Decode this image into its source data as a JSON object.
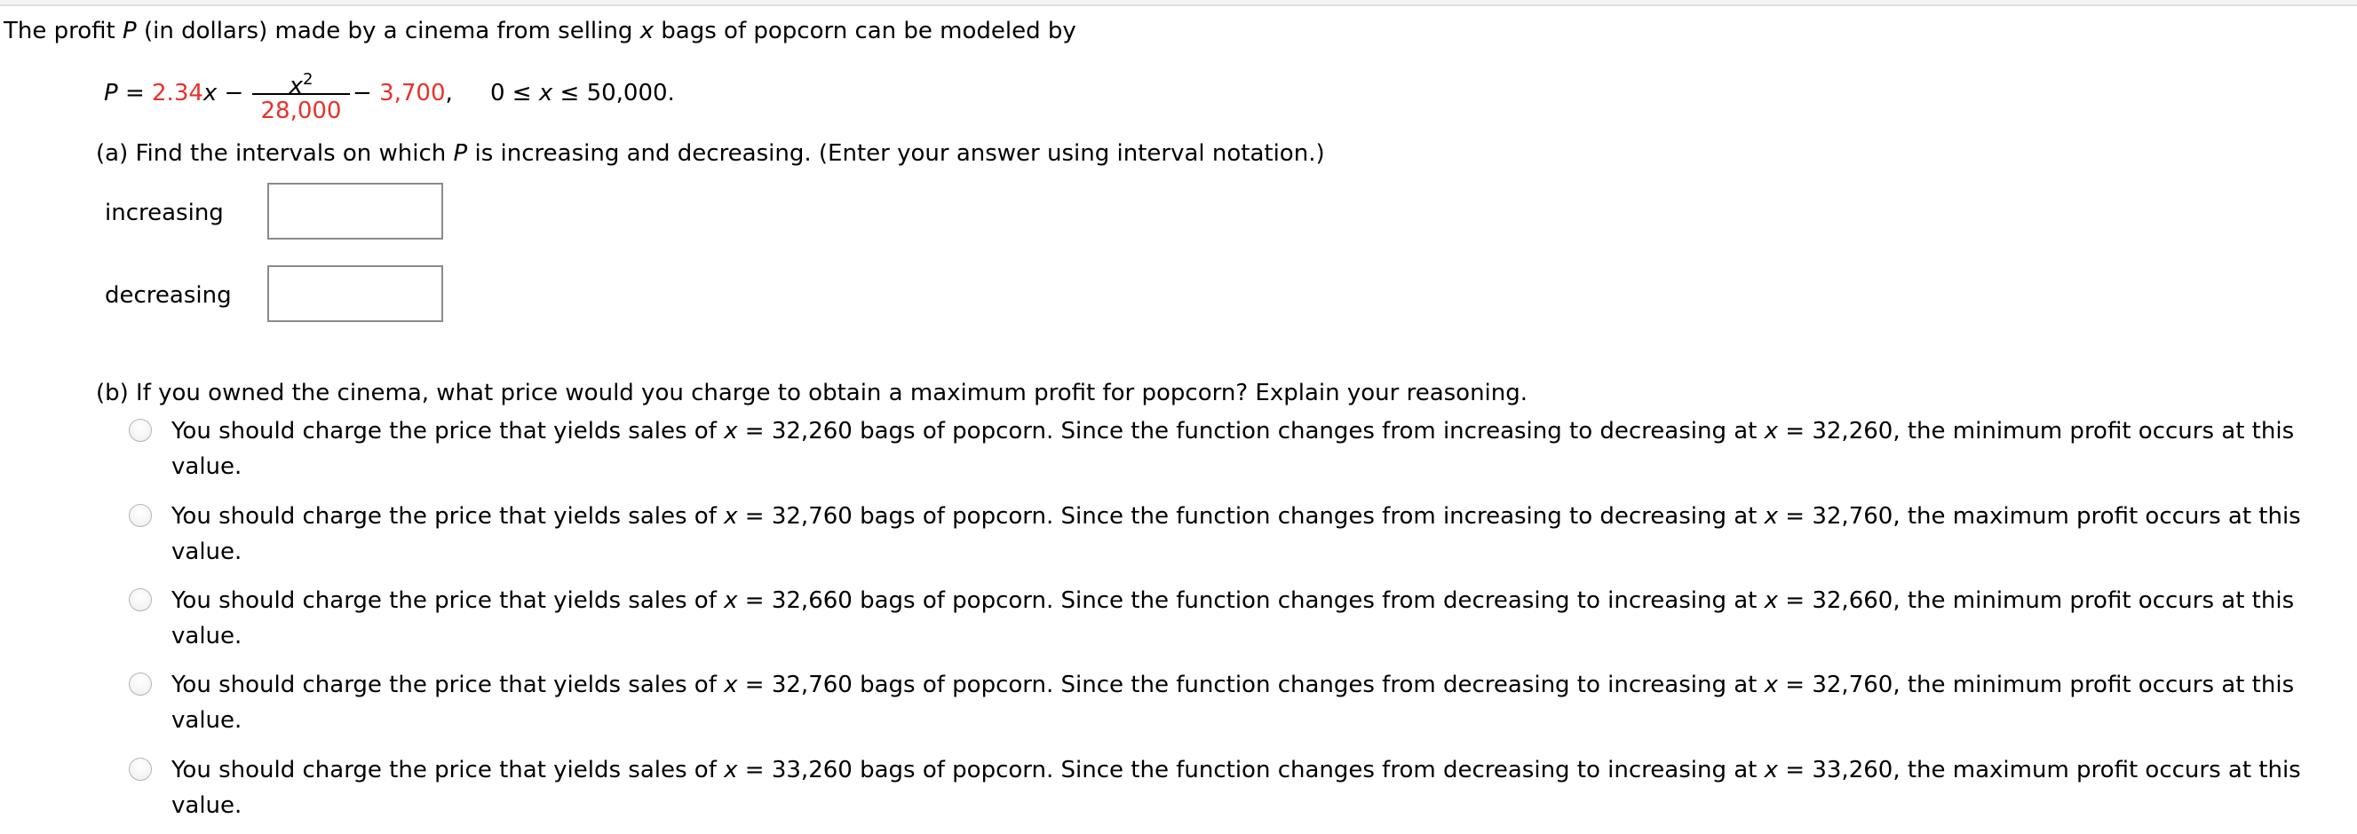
{
  "intro": {
    "before_P": "The profit ",
    "var_P": "P",
    "middle": " (in dollars) made by a cinema from selling ",
    "var_x": "x",
    "after": " bags of popcorn can be modeled by"
  },
  "formula": {
    "lhs": "P",
    "equals": " = ",
    "coef": "2.34",
    "var_x": "x",
    "minus1": " − ",
    "numerator_var": "x",
    "numerator_exp": "2",
    "denominator": "28,000",
    "minus2": " − ",
    "constant": "3,700",
    "comma": ",",
    "domain_lo": "0 ≤ ",
    "domain_var": "x",
    "domain_hi": " ≤ 50,000."
  },
  "part_a": {
    "prefix": "(a) Find the intervals on which ",
    "var_P": "P",
    "suffix": " is increasing and decreasing. (Enter your answer using interval notation.)",
    "fields": [
      {
        "label": "increasing",
        "value": ""
      },
      {
        "label": "decreasing",
        "value": ""
      }
    ]
  },
  "part_b": {
    "question": "(b) If you owned the cinema, what price would you charge to obtain a maximum profit for popcorn? Explain your reasoning.",
    "options": [
      {
        "pre": "You should charge the price that yields sales of ",
        "var": "x",
        "mid1": " = 32,260 bags of popcorn. Since the function changes from increasing to decreasing at ",
        "var2": "x",
        "mid2": " = 32,260, the minimum profit occurs at this value.",
        "selected": false
      },
      {
        "pre": "You should charge the price that yields sales of ",
        "var": "x",
        "mid1": " = 32,760 bags of popcorn. Since the function changes from increasing to decreasing at ",
        "var2": "x",
        "mid2": " = 32,760, the maximum profit occurs at this value.",
        "selected": false
      },
      {
        "pre": "You should charge the price that yields sales of ",
        "var": "x",
        "mid1": " = 32,660 bags of popcorn. Since the function changes from decreasing to increasing at ",
        "var2": "x",
        "mid2": " = 32,660, the minimum profit occurs at this value.",
        "selected": false
      },
      {
        "pre": "You should charge the price that yields sales of ",
        "var": "x",
        "mid1": " = 32,760 bags of popcorn. Since the function changes from decreasing to increasing at ",
        "var2": "x",
        "mid2": " = 32,760, the minimum profit occurs at this value.",
        "selected": false
      },
      {
        "pre": "You should charge the price that yields sales of ",
        "var": "x",
        "mid1": " = 33,260 bags of popcorn. Since the function changes from decreasing to increasing at ",
        "var2": "x",
        "mid2": " = 33,260, the maximum profit occurs at this value.",
        "selected": false
      }
    ]
  },
  "colors": {
    "highlight_red": "#e8322a",
    "input_border": "#8a8a8a"
  }
}
